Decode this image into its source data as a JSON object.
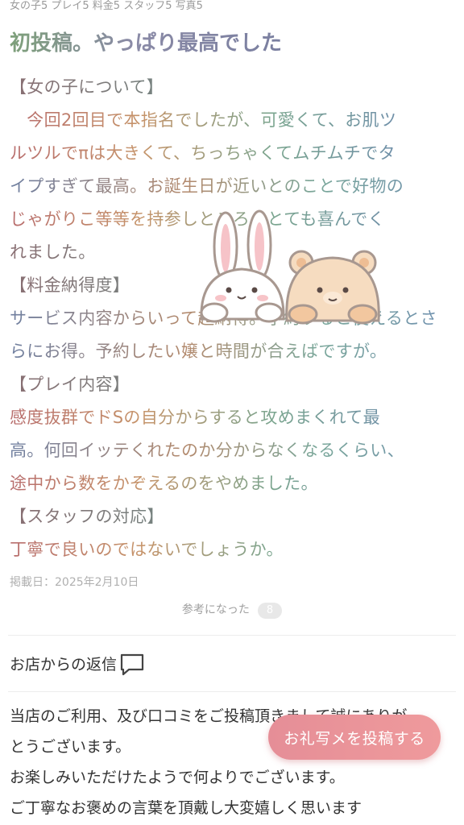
{
  "review": {
    "ratings_line": "女の子5 プレイ5 料金5 スタッフ5 写真5",
    "title": "初投稿。やっぱり最高でした",
    "sections": [
      {
        "heading": "【女の子について】",
        "lines": [
          "　今回2回目で本指名でしたが、可愛くて、お肌ツ",
          "ルツルでπは大きくて、ちっちゃくてムチムチでタ",
          "イプすぎて最高。お誕生日が近いとのことで好物の",
          "じゃがりこ等等を持参しところ、とても喜んでく",
          "れました。"
        ]
      },
      {
        "heading": "【料金納得度】",
        "lines": [
          "サービス内容からいって超納得。予約すると使えるとさ",
          "らにお得。予約したい嬢と時間が合えばですが。"
        ]
      },
      {
        "heading": "【プレイ内容】",
        "lines": [
          "感度抜群でドSの自分からすると攻めまくれて最",
          "高。何回イッテくれたのか分からなくなるくらい、",
          "途中から数をかぞえるのをやめました。"
        ]
      },
      {
        "heading": "【スタッフの対応】",
        "lines": [
          "丁寧で良いのではないでしょうか。"
        ]
      }
    ],
    "posted": "掲載日：2025年2月10日",
    "helpful_label": "参考になった",
    "helpful_count": "8"
  },
  "reply": {
    "heading": "お店からの返信",
    "icon": "speech-bubble-icon",
    "lines": [
      "当店のご利用、及び口コミをご投稿頂きまして誠にありが",
      "とうございます。",
      "お楽しみいただけたようで何よりでございます。",
      "ご丁寧なお褒めの言葉を頂戴し大変嬉しく思います"
    ]
  },
  "fab": {
    "label": "お礼写メを投稿する"
  },
  "sticker": {
    "name": "bunny-and-bear-sticker"
  },
  "colors": {
    "accent_pink": "#e8919a",
    "divider": "#ececec"
  }
}
